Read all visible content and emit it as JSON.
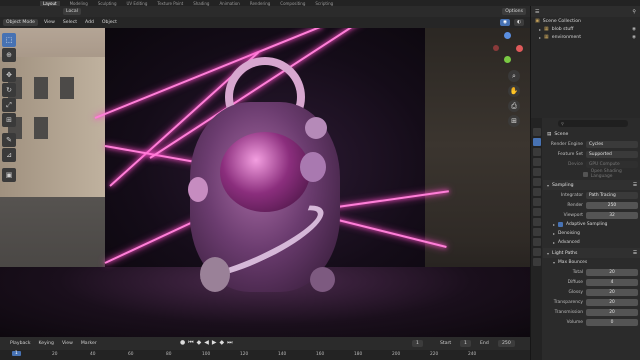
{
  "menubar": {
    "items": [
      "Layout",
      "Modeling",
      "Sculpting",
      "UV Editing",
      "Texture Paint",
      "Shading",
      "Animation",
      "Rendering",
      "Compositing",
      "Scripting"
    ],
    "active_index": 0
  },
  "viewport_header": {
    "mode": "Object Mode",
    "menus": [
      "View",
      "Select",
      "Add",
      "Object"
    ],
    "orientation": "Local",
    "options": "Options"
  },
  "toolbar": {
    "tools": [
      "select-box",
      "cursor",
      "move",
      "rotate",
      "scale",
      "transform",
      "annotate",
      "measure",
      "add-cube"
    ],
    "active_index": 0
  },
  "outliner": {
    "title": "Scene Collection",
    "items": [
      {
        "label": "blob stuff",
        "icon": "collection-icon"
      },
      {
        "label": "environment",
        "icon": "collection-icon"
      }
    ]
  },
  "properties": {
    "scene_label": "Scene",
    "render_engine_label": "Render Engine",
    "render_engine": "Cycles",
    "feature_set_label": "Feature Set",
    "feature_set": "Supported",
    "device_label": "Device",
    "device": "GPU Compute",
    "open_shading_label": "Open Shading Language",
    "sampling_label": "Sampling",
    "integrator_label": "Integrator",
    "integrator": "Path Tracing",
    "render_label": "Render",
    "render_samples": "250",
    "viewport_label": "Viewport",
    "viewport_samples": "32",
    "adaptive_label": "Adaptive Sampling",
    "denoising_label": "Denoising",
    "advanced_label": "Advanced",
    "light_paths_label": "Light Paths",
    "max_bounces_label": "Max Bounces",
    "total_label": "Total",
    "total": "20",
    "diffuse_label": "Diffuse",
    "diffuse": "4",
    "glossy_label": "Glossy",
    "glossy": "20",
    "transparency_label": "Transparency",
    "transparency": "20",
    "transmission_label": "Transmission",
    "transmission": "20",
    "volume_label": "Volume",
    "volume": "0"
  },
  "timeline": {
    "playback": "Playback",
    "keying": "Keying",
    "view": "View",
    "marker": "Marker",
    "current_frame": "1",
    "start_label": "Start",
    "start": "1",
    "end_label": "End",
    "end": "250",
    "ruler": [
      "1",
      "20",
      "40",
      "60",
      "80",
      "100",
      "120",
      "140",
      "160",
      "180",
      "200",
      "220",
      "240"
    ]
  },
  "colors": {
    "accent": "#4772b3",
    "neon": "#ff7fd8"
  }
}
